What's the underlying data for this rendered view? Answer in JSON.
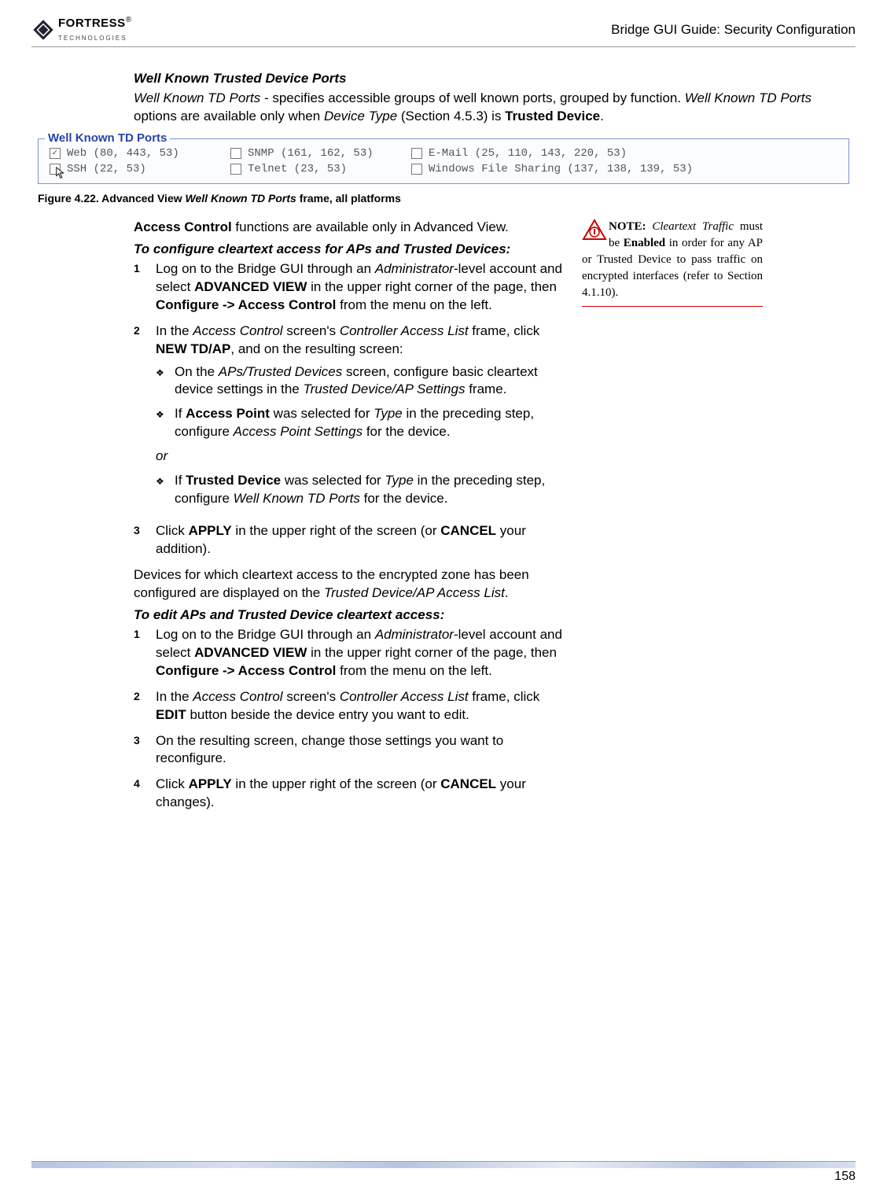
{
  "header": {
    "logo_main": "FORTRESS",
    "logo_sub": "TECHNOLOGIES",
    "logo_reg": "®",
    "title": "Bridge GUI Guide: Security Configuration"
  },
  "section_heading": "Well Known Trusted Device Ports",
  "intro": {
    "lead_ital": "Well Known TD Ports",
    "lead_rest": " - specifies accessible groups of well known ports, grouped by function. ",
    "mid_ital": "Well Known TD Ports",
    "mid_rest": " options are available only when ",
    "dtype_ital": "Device Type",
    "section_ref": " (Section 4.5.3) is ",
    "trusted_bold": "Trusted Device",
    "period": "."
  },
  "ports_frame": {
    "legend": "Well Known TD Ports",
    "items": {
      "web": {
        "label": "Web (80, 443, 53)",
        "checked": true
      },
      "ssh": {
        "label": "SSH (22, 53)",
        "checked": false
      },
      "snmp": {
        "label": "SNMP (161, 162, 53)",
        "checked": false
      },
      "telnet": {
        "label": "Telnet (23, 53)",
        "checked": false
      },
      "email": {
        "label": "E-Mail (25, 110, 143, 220, 53)",
        "checked": false
      },
      "wfs": {
        "label": "Windows File Sharing (137, 138, 139, 53)",
        "checked": false
      }
    }
  },
  "fig_caption": {
    "prefix": "Figure 4.22. Advanced View ",
    "ital": "Well Known TD Ports",
    "suffix": " frame, all platforms"
  },
  "access_line": {
    "bold": "Access Control",
    "rest": " functions are available only in Advanced View."
  },
  "proc1_heading": "To configure cleartext access for APs and Trusted Devices:",
  "proc1": {
    "s1": {
      "a": "Log on to the Bridge GUI through an ",
      "b_ital": "Administrator",
      "c": "-level account and select ",
      "d_sc": "ADVANCED VIEW",
      "e": " in the upper right corner of the page, then ",
      "f_bold": "Configure -> Access Control",
      "g": " from the menu on the left."
    },
    "s2": {
      "a": "In the ",
      "b_ital": "Access Control",
      "c": " screen's ",
      "d_ital": "Controller Access List",
      "e": " frame, click ",
      "f_sc": "NEW TD/AP",
      "g": ", and on the resulting screen:"
    },
    "s2_sub1": {
      "a": "On the ",
      "b_ital": "APs/Trusted Devices",
      "c": " screen, configure basic cleartext device settings in the ",
      "d_ital": "Trusted Device/AP Settings",
      "e": " frame."
    },
    "s2_sub2": {
      "a": "If ",
      "b_bold": "Access Point",
      "c": " was selected for ",
      "d_ital": "Type",
      "e": " in the preceding step, configure ",
      "f_ital": "Access Point Settings",
      "g": " for the device."
    },
    "or": "or",
    "s2_sub3": {
      "a": "If ",
      "b_bold": "Trusted Device",
      "c": " was selected for ",
      "d_ital": "Type",
      "e": " in the preceding step, configure ",
      "f_ital": "Well Known TD Ports",
      "g": " for the device."
    },
    "s3": {
      "a": "Click ",
      "b_sc": "APPLY",
      "c": " in the upper right of the screen (or ",
      "d_sc": "CANCEL",
      "e": " your addition)."
    }
  },
  "mid_para": {
    "a": "Devices for which cleartext access to the encrypted zone has been configured are displayed on the ",
    "b_ital": "Trusted Device/AP Access List",
    "c": "."
  },
  "proc2_heading": "To edit APs and Trusted Device cleartext access:",
  "proc2": {
    "s1": {
      "a": "Log on to the Bridge GUI through an ",
      "b_ital": "Administrator",
      "c": "-level account and select ",
      "d_sc": "ADVANCED VIEW",
      "e": " in the upper right corner of the page, then ",
      "f_bold": "Configure -> Access Control",
      "g": " from the menu on the left."
    },
    "s2": {
      "a": "In the ",
      "b_ital": "Access Control",
      "c": " screen's ",
      "d_ital": "Controller Access List",
      "e": " frame, click ",
      "f_sc": "EDIT",
      "g": " button beside the device entry you want to edit."
    },
    "s3": {
      "a": "On the resulting screen, change those settings you want to reconfigure."
    },
    "s4": {
      "a": "Click ",
      "b_sc": "APPLY",
      "c": " in the upper right of the screen (or ",
      "d_sc": "CANCEL",
      "e": " your changes)."
    }
  },
  "note": {
    "label": "NOTE:",
    "a_ital": "Cleartext Traffic",
    "b": " must be ",
    "c_bold": "Enabled",
    "d": " in order for any AP or Trusted Device to pass traffic on encrypted interfaces (refer to Section 4.1.10)."
  },
  "page_number": "158"
}
